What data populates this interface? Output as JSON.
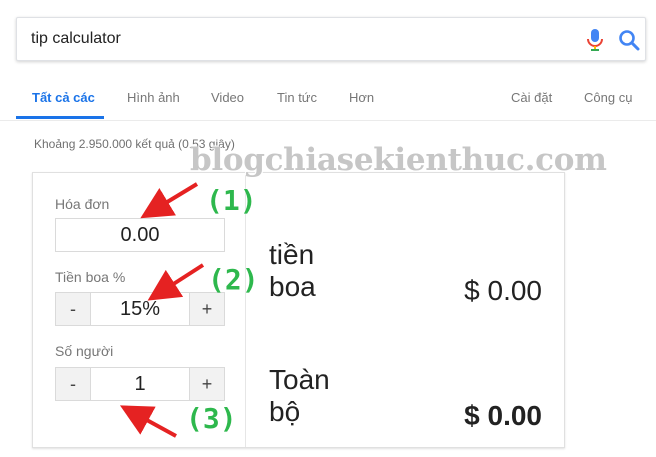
{
  "search": {
    "query": "tip calculator"
  },
  "tabs": [
    {
      "label": "Tất cả các",
      "active": true
    },
    {
      "label": "Hình ảnh"
    },
    {
      "label": "Video"
    },
    {
      "label": "Tin tức"
    },
    {
      "label": "Hơn"
    },
    {
      "label": "Cài đặt"
    },
    {
      "label": "Công cụ"
    }
  ],
  "result_stats": "Khoảng 2.950.000 kết quả (0.53 giây)",
  "watermark": "blogchiasekienthuc.com",
  "calculator": {
    "bill_label": "Hóa đơn",
    "bill_value": "0.00",
    "tip_label": "Tiền boa %",
    "tip_value": "15%",
    "people_label": "Số người",
    "people_value": "1",
    "minus": "-",
    "plus": "+",
    "tip_result_label_1": "tiền",
    "tip_result_label_2": "boa",
    "tip_result_value": "$ 0.00",
    "total_label_1": "Toàn",
    "total_label_2": "bộ",
    "total_value": "$ 0.00"
  },
  "annotations": [
    "(1)",
    "(2)",
    "(3)"
  ],
  "colors": {
    "accent": "#1a73e8",
    "annotation_arrow": "#e52222",
    "annotation_number": "#2eb84d"
  }
}
